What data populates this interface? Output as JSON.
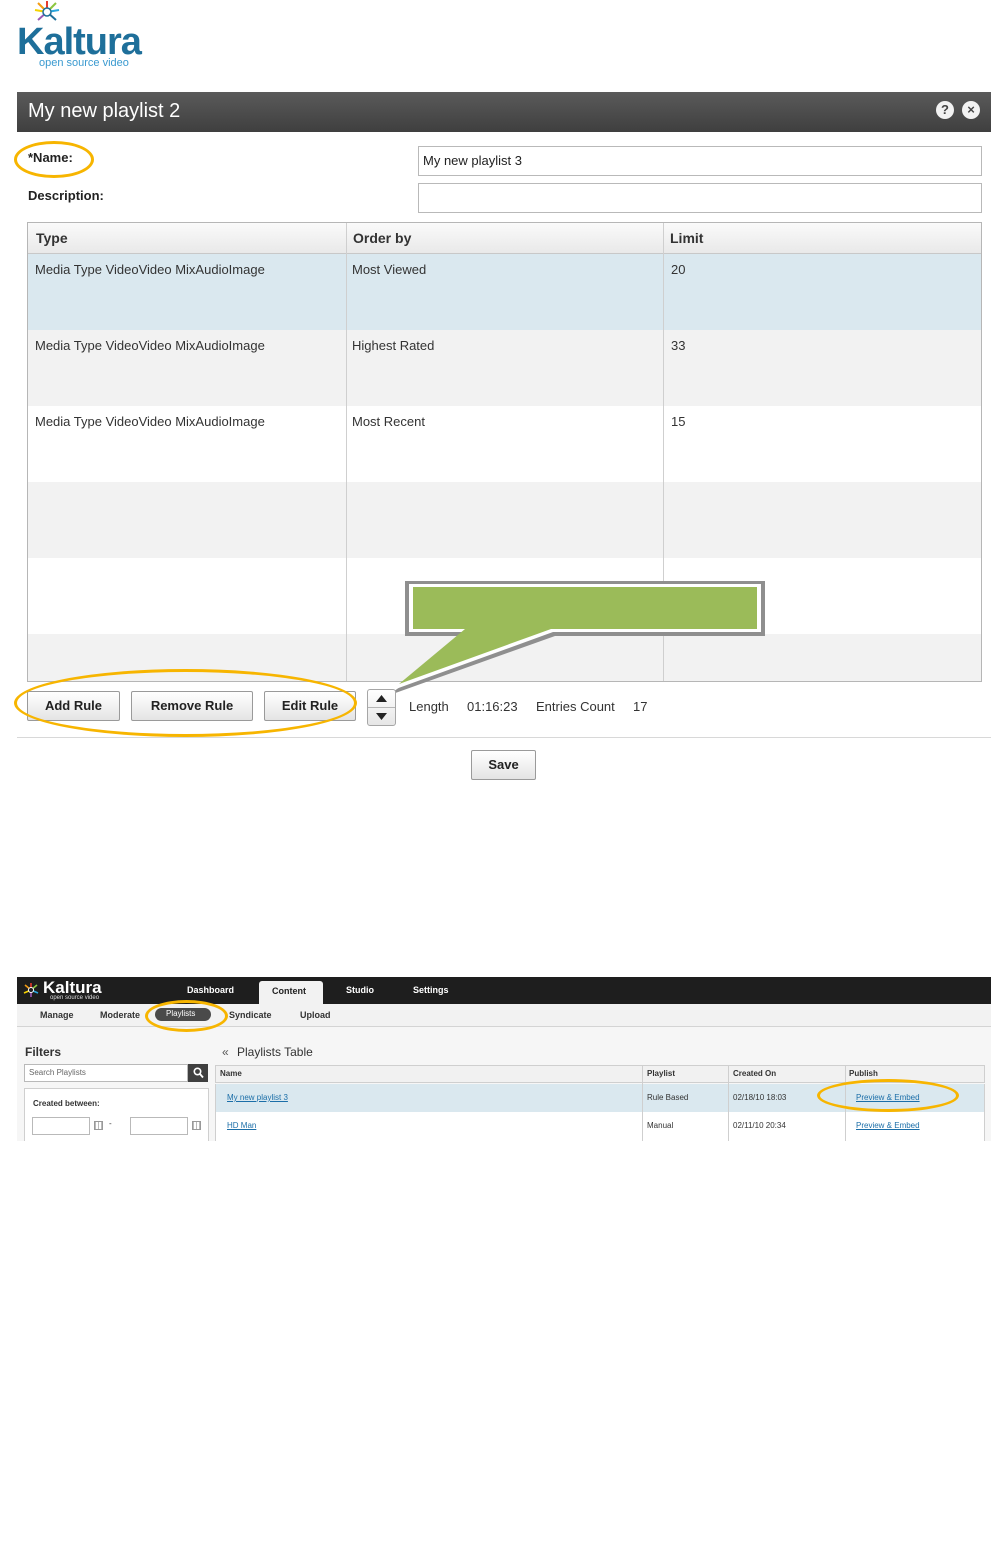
{
  "logo": {
    "name": "Kaltura",
    "tagline": "open source video"
  },
  "dialog": {
    "title": "My new playlist 2",
    "help_icon": "?",
    "close_icon": "×",
    "name_label": "*Name:",
    "name_value": "My new playlist 3",
    "description_label": "Description:",
    "description_value": "",
    "columns": [
      "Type",
      "Order by",
      "Limit"
    ],
    "rows": [
      {
        "type": "Media Type VideoVideo MixAudioImage",
        "order": "Most Viewed",
        "limit": "20"
      },
      {
        "type": "Media Type VideoVideo MixAudioImage",
        "order": "Highest Rated",
        "limit": "33"
      },
      {
        "type": "Media Type VideoVideo MixAudioImage",
        "order": "Most Recent",
        "limit": "15"
      }
    ],
    "add_rule": "Add Rule",
    "remove_rule": "Remove Rule",
    "edit_rule": "Edit Rule",
    "length_label": "Length",
    "length_value": "01:16:23",
    "entries_label": "Entries Count",
    "entries_value": "17",
    "save": "Save",
    "selected_row": 0
  },
  "callout": {
    "text": "",
    "color": "#9bbb59"
  },
  "highlight_color": "#f7b500",
  "kmc": {
    "logo": "Kaltura",
    "logo_tagline": "open source video",
    "main_tabs": [
      "Dashboard",
      "Content",
      "Studio",
      "Settings"
    ],
    "active_tab": "Content",
    "sub_tabs": [
      "Manage",
      "Moderate",
      "Playlists",
      "Syndicate",
      "Upload"
    ],
    "active_sub_tab": "Playlists",
    "filters_title": "Filters",
    "search_placeholder": "Search Playlists",
    "created_between": "Created between:",
    "date_separator": "-",
    "table_title": "Playlists Table",
    "collapse_icon": "«",
    "columns": [
      "Name",
      "Playlist",
      "Created On",
      "Publish"
    ],
    "rows": [
      {
        "name": "My new playlist 3",
        "playlist": "Rule Based",
        "created": "02/18/10 18:03",
        "publish": "Preview & Embed"
      },
      {
        "name": "HD Man",
        "playlist": "Manual",
        "created": "02/11/10 20:34",
        "publish": "Preview & Embed"
      }
    ]
  }
}
